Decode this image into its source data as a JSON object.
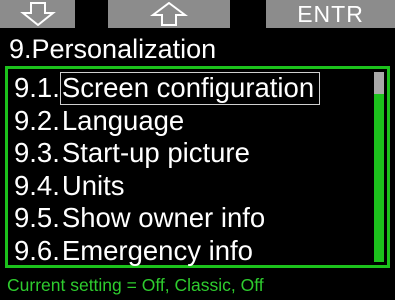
{
  "softkeys": {
    "left_icon": "arrow-down-icon",
    "middle_icon": "arrow-up-icon",
    "right_label": "ENTR"
  },
  "header": {
    "title": "9.Personalization"
  },
  "menu": {
    "selected_index": 0,
    "items": [
      {
        "number": "9.1.",
        "label": "Screen configuration"
      },
      {
        "number": "9.2.",
        "label": "Language"
      },
      {
        "number": "9.3.",
        "label": "Start-up picture"
      },
      {
        "number": "9.4.",
        "label": "Units"
      },
      {
        "number": "9.5.",
        "label": "Show owner info"
      },
      {
        "number": "9.6.",
        "label": "Emergency info"
      }
    ]
  },
  "status": {
    "current_setting": "Current setting = Off, Classic, Off"
  },
  "colors": {
    "accent_green": "#1cc21c",
    "softkey_gray": "#8c8c8c",
    "status_green": "#2ecc2e"
  }
}
